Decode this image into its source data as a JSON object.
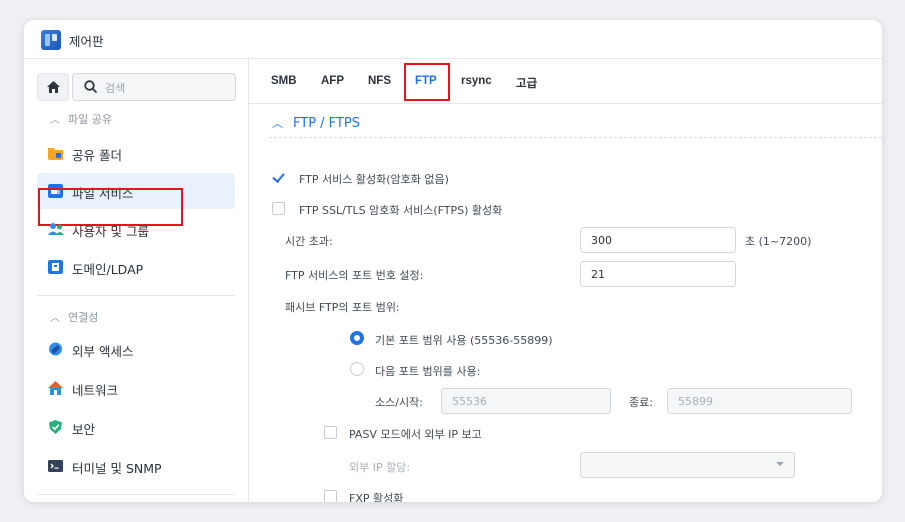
{
  "window": {
    "title": "제어판"
  },
  "search": {
    "placeholder": "검색"
  },
  "sidebar": {
    "sections": [
      {
        "label": "파일 공유"
      },
      {
        "label": "연결성"
      }
    ],
    "items": [
      {
        "label": "공유 폴더",
        "icon": "folder-icon",
        "color": "#f5a623"
      },
      {
        "label": "파일 서비스",
        "icon": "file-services-icon",
        "color": "#1f73e5"
      },
      {
        "label": "사용자 및 그룹",
        "icon": "users-icon",
        "color": "#2f8fe8"
      },
      {
        "label": "도메인/LDAP",
        "icon": "domain-icon",
        "color": "#1f73e5"
      },
      {
        "label": "외부 액세스",
        "icon": "external-access-icon",
        "color": "#2f8fe8"
      },
      {
        "label": "네트워크",
        "icon": "network-icon",
        "color": "#e85d3a"
      },
      {
        "label": "보안",
        "icon": "shield-icon",
        "color": "#26b07a"
      },
      {
        "label": "터미널 및 SNMP",
        "icon": "terminal-icon",
        "color": "#33415c"
      }
    ]
  },
  "tabs": [
    "SMB",
    "AFP",
    "NFS",
    "FTP",
    "rsync",
    "고급"
  ],
  "active_tab": "FTP",
  "ftp": {
    "group_title": "FTP / FTPS",
    "enable_ftp": "FTP 서비스 활성화(암호화 없음)",
    "enable_ftps": "FTP SSL/TLS 암호화 서비스(FTPS) 활성화",
    "timeout_label": "시간 초과:",
    "timeout_value": "300",
    "timeout_unit": "초 (1~7200)",
    "port_label": "FTP 서비스의 포트 번호 설정:",
    "port_value": "21",
    "passive_label": "패시브 FTP의 포트 범위:",
    "default_range": "기본 포트 범위 사용 (55536-55899)",
    "custom_range": "다음 포트 범위를 사용:",
    "from_label": "소스/시작:",
    "from_value": "55536",
    "to_label": "종료:",
    "to_value": "55899",
    "pasv_report": "PASV 모드에서 외부 IP 보고",
    "external_ip_label": "외부 IP 할당:",
    "external_ip_value": "",
    "fxp": "FXP 활성화"
  },
  "colors": {
    "accent": "#1f73e5",
    "highlight": "#e3141b"
  }
}
